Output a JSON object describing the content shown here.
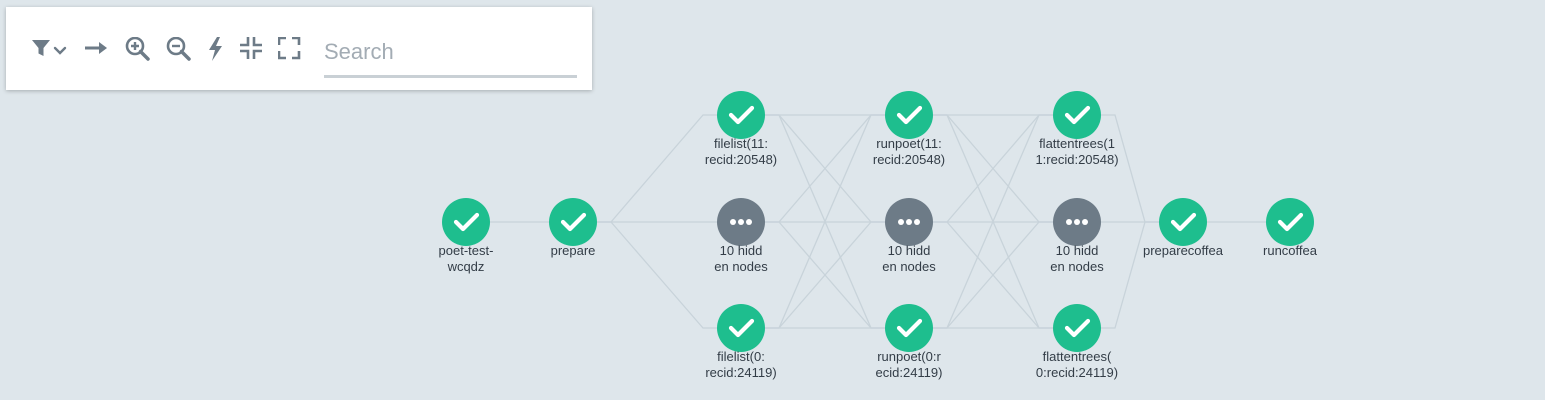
{
  "toolbar": {
    "icons": [
      "filter-icon",
      "chevron-down-icon",
      "arrow-right-icon",
      "zoom-in-icon",
      "zoom-out-icon",
      "lightning-icon",
      "collapse-icon",
      "expand-icon"
    ],
    "search_placeholder": "Search"
  },
  "colors": {
    "success": "#1ebe8e",
    "pending": "#6d7b87",
    "edge": "#c8d3da",
    "background": "#dee6eb"
  },
  "nodes": [
    {
      "id": "n1",
      "status": "success",
      "label_lines": [
        "poet-test-",
        "wcqdz"
      ]
    },
    {
      "id": "n2",
      "status": "success",
      "label_lines": [
        "prepare"
      ]
    },
    {
      "id": "n3",
      "status": "success",
      "label_lines": [
        "filelist(11:",
        "recid:20548)"
      ]
    },
    {
      "id": "n4",
      "status": "hidden",
      "label_lines": [
        "10 hidd",
        "en nodes"
      ]
    },
    {
      "id": "n5",
      "status": "success",
      "label_lines": [
        "filelist(0:",
        "recid:24119)"
      ]
    },
    {
      "id": "n6",
      "status": "success",
      "label_lines": [
        "runpoet(11:",
        "recid:20548)"
      ]
    },
    {
      "id": "n7",
      "status": "hidden",
      "label_lines": [
        "10 hidd",
        "en nodes"
      ]
    },
    {
      "id": "n8",
      "status": "success",
      "label_lines": [
        "runpoet(0:r",
        "ecid:24119)"
      ]
    },
    {
      "id": "n9",
      "status": "success",
      "label_lines": [
        "flattentrees(1",
        "1:recid:20548)"
      ]
    },
    {
      "id": "n10",
      "status": "hidden",
      "label_lines": [
        "10 hidd",
        "en nodes"
      ]
    },
    {
      "id": "n11",
      "status": "success",
      "label_lines": [
        "flattentrees(",
        "0:recid:24119)"
      ]
    },
    {
      "id": "n12",
      "status": "success",
      "label_lines": [
        "preparecoffea"
      ]
    },
    {
      "id": "n13",
      "status": "success",
      "label_lines": [
        "runcoffea"
      ]
    }
  ],
  "edges": [
    [
      "n1",
      "n2"
    ],
    [
      "n2",
      "n3"
    ],
    [
      "n2",
      "n4"
    ],
    [
      "n2",
      "n5"
    ],
    [
      "n3",
      "n6"
    ],
    [
      "n3",
      "n7"
    ],
    [
      "n3",
      "n8"
    ],
    [
      "n4",
      "n6"
    ],
    [
      "n4",
      "n7"
    ],
    [
      "n4",
      "n8"
    ],
    [
      "n5",
      "n6"
    ],
    [
      "n5",
      "n7"
    ],
    [
      "n5",
      "n8"
    ],
    [
      "n6",
      "n9"
    ],
    [
      "n6",
      "n10"
    ],
    [
      "n6",
      "n11"
    ],
    [
      "n7",
      "n9"
    ],
    [
      "n7",
      "n10"
    ],
    [
      "n7",
      "n11"
    ],
    [
      "n8",
      "n9"
    ],
    [
      "n8",
      "n10"
    ],
    [
      "n8",
      "n11"
    ],
    [
      "n9",
      "n12"
    ],
    [
      "n10",
      "n12"
    ],
    [
      "n11",
      "n12"
    ],
    [
      "n12",
      "n13"
    ]
  ]
}
